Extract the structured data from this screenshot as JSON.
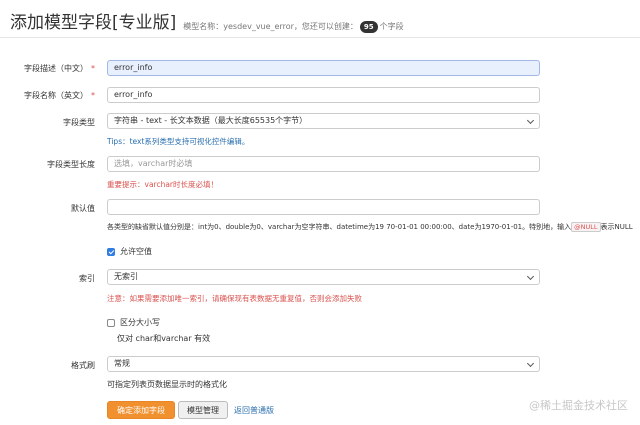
{
  "header": {
    "title": "添加模型字段[专业版]",
    "model_prefix": "模型名称：yesdev_vue_error，您还可以创建：",
    "remaining_count": "95",
    "suffix": "个字段"
  },
  "form": {
    "field_desc": {
      "label": "字段描述（中文）",
      "required_mark": "*",
      "value": "error_info"
    },
    "field_name": {
      "label": "字段名称（英文）",
      "required_mark": "*",
      "value": "error_info"
    },
    "field_type": {
      "label": "字段类型",
      "selected": "字符串 - text - 长文本数据（最大长度65535个字节）",
      "tips": "Tips：text系列类型支持可视化控件编辑。"
    },
    "field_length": {
      "label": "字段类型长度",
      "placeholder": "选填，varchar时必填",
      "warning": "重要提示：varchar时长度必填！"
    },
    "default_value": {
      "label": "默认值",
      "value": "",
      "help_before": "各类型的缺省默认值分别是：int为0、double为0、varchar为空字符串、datetime为19 70-01-01 00:00:00、date为1970-01-01。特别地，输入",
      "help_code": "@NULL",
      "help_after": "表示NULL"
    },
    "allow_null": {
      "label": "允许空值",
      "checked": true
    },
    "index": {
      "label": "索引",
      "selected": "无索引",
      "warning": "注意：如果需要添加唯一索引，请确保现有表数据无重复值，否则会添加失败"
    },
    "case_sensitive": {
      "label": "区分大小写",
      "checked": false,
      "note": "仅对 char和varchar 有效"
    },
    "formatter": {
      "label": "格式刷",
      "selected": "常规",
      "help": "可指定列表页数据显示时的格式化"
    }
  },
  "actions": {
    "submit_label": "确定添加字段",
    "manage_label": "模型管理",
    "back_label": "返回普通版"
  },
  "watermark": "@稀土掘金技术社区",
  "colors": {
    "primary_button": "#f0902e",
    "link": "#2a6fb0",
    "warning": "#d9534f",
    "checkbox": "#2f7de1"
  }
}
